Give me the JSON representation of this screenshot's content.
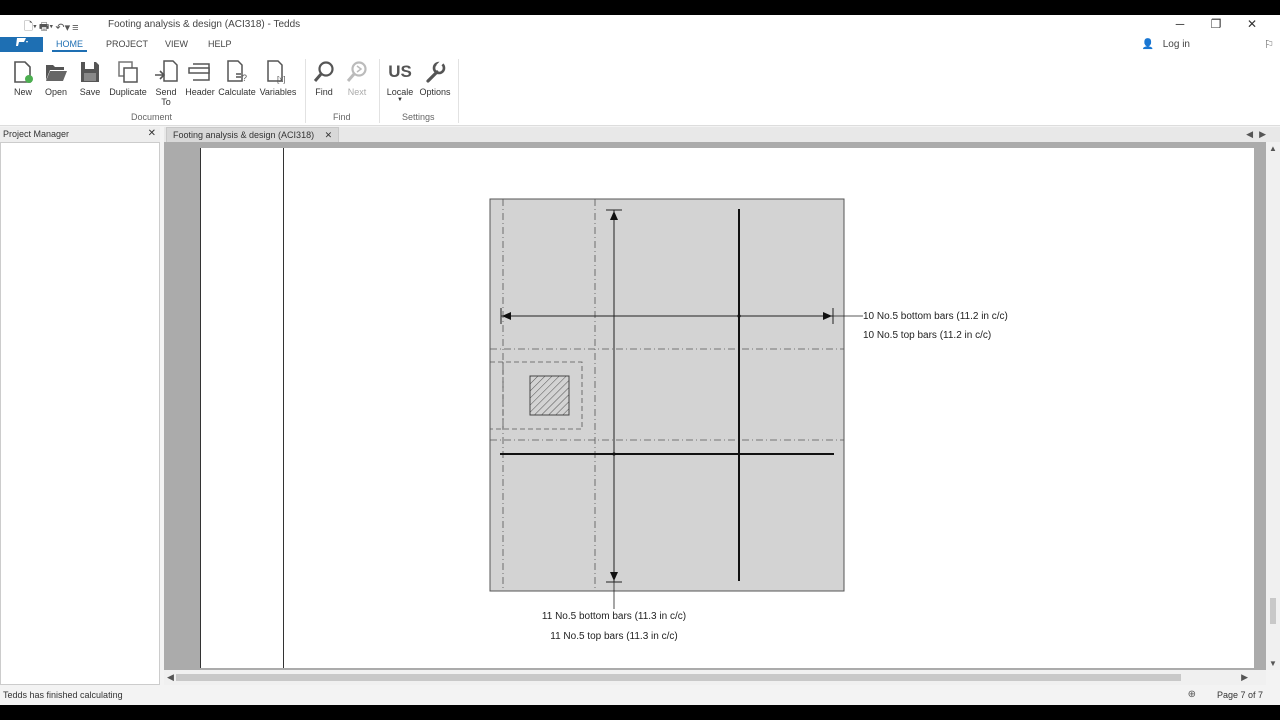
{
  "window": {
    "title": "Footing analysis & design (ACI318) - Tedds",
    "minimize": "─",
    "restore": "❐",
    "close": "✕"
  },
  "ribbon_tabs": [
    {
      "label": "HOME",
      "active": true
    },
    {
      "label": "PROJECT",
      "active": false
    },
    {
      "label": "VIEW",
      "active": false
    },
    {
      "label": "HELP",
      "active": false
    }
  ],
  "login_label": "Log in",
  "ribbon": {
    "document_group": "Document",
    "find_group": "Find",
    "settings_group": "Settings",
    "buttons": {
      "new": "New",
      "open": "Open",
      "save": "Save",
      "duplicate": "Duplicate",
      "send_to_line1": "Send",
      "send_to_line2": "To",
      "header": "Header",
      "calculate": "Calculate",
      "variables": "Variables",
      "find": "Find",
      "next": "Next",
      "locale": "Locale",
      "locale_glyph": "US",
      "options": "Options"
    }
  },
  "project_manager": {
    "title": "Project Manager",
    "close": "✕"
  },
  "document_tab": {
    "label": "Footing analysis & design (ACI318)",
    "close": "✕"
  },
  "drawing": {
    "x_bars_bottom": "10 No.5 bottom bars (11.2 in c/c)",
    "x_bars_top": "10 No.5 top bars (11.2 in c/c)",
    "y_bars_bottom": "11 No.5 bottom bars (11.3 in c/c)",
    "y_bars_top": "11 No.5 top bars (11.3 in c/c)"
  },
  "status": {
    "message": "Tedds has finished calculating",
    "page": "Page 7 of 7"
  },
  "colors": {
    "accent": "#1e6fb3",
    "footing_fill": "#d3d3d3",
    "page_bg": "#ababab"
  }
}
